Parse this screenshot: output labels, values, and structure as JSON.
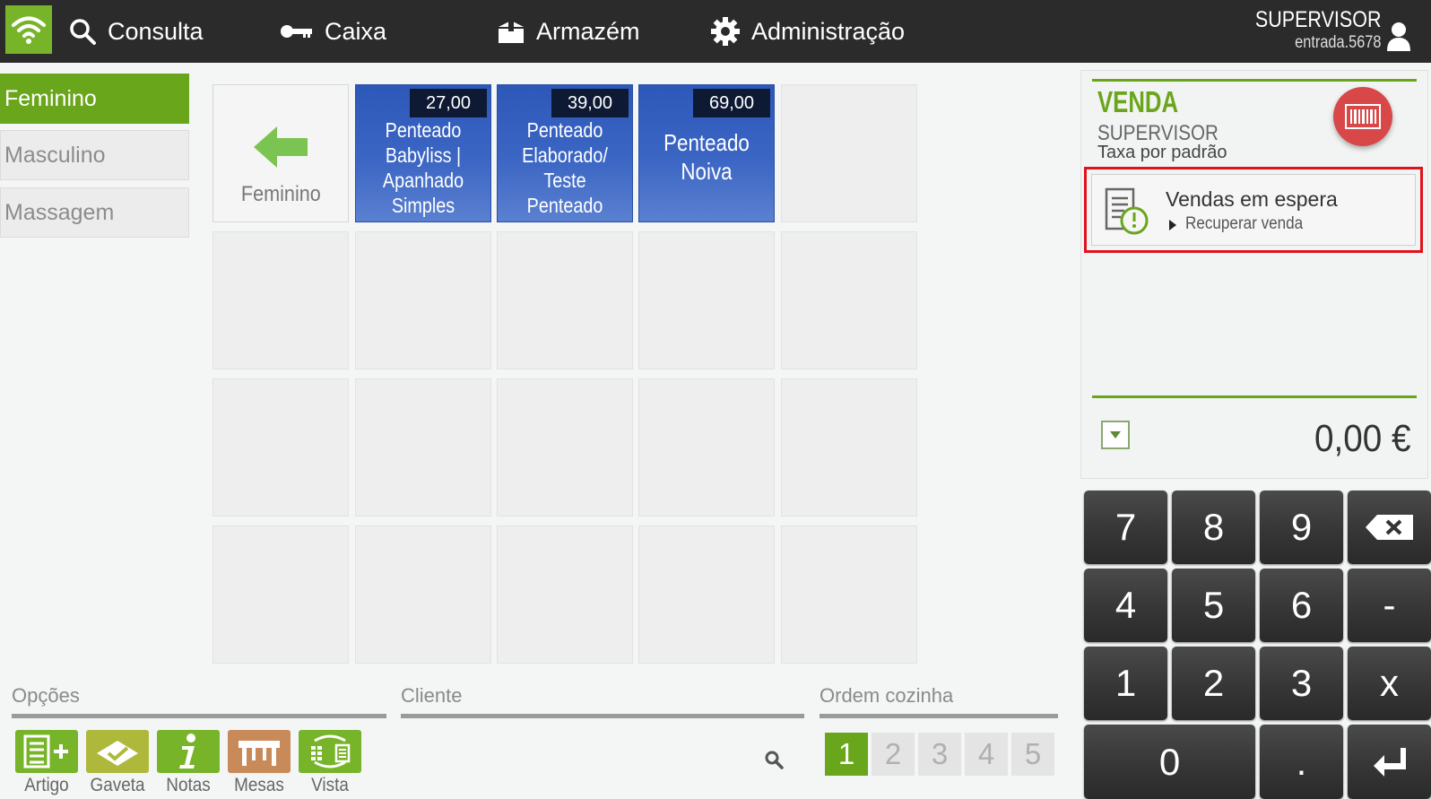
{
  "topbar": {
    "nav": [
      {
        "label": "Consulta",
        "icon": "search-icon"
      },
      {
        "label": "Caixa",
        "icon": "key-icon"
      },
      {
        "label": "Armazém",
        "icon": "box-icon"
      },
      {
        "label": "Administração",
        "icon": "gear-icon"
      }
    ],
    "user_name": "SUPERVISOR",
    "user_sub": "entrada.5678",
    "wifi_color": "#78b42a"
  },
  "categories": [
    {
      "label": "Feminino",
      "active": true
    },
    {
      "label": "Masculino",
      "active": false
    },
    {
      "label": "Massagem",
      "active": false
    }
  ],
  "grid": {
    "back_label": "Feminino",
    "products": [
      {
        "price": "27,00",
        "name_lines": [
          "Penteado",
          "Babyliss |",
          "Apanhado",
          "Simples"
        ]
      },
      {
        "price": "39,00",
        "name_lines": [
          "Penteado",
          "Elaborado/ Teste",
          "Penteado"
        ]
      },
      {
        "price": "69,00",
        "name_lines": [
          "Penteado",
          "Noiva"
        ]
      }
    ]
  },
  "bottom": {
    "options_title": "Opções",
    "client_title": "Cliente",
    "kitchen_title": "Ordem cozinha",
    "options": [
      {
        "label": "Artigo",
        "icon": "add-article-icon",
        "color": "#78b42a"
      },
      {
        "label": "Gaveta",
        "icon": "drawer-icon",
        "color": "#aeb83a"
      },
      {
        "label": "Notas",
        "icon": "info-icon",
        "color": "#78b42a"
      },
      {
        "label": "Mesas",
        "icon": "table-icon",
        "color": "#c98a5a"
      },
      {
        "label": "Vista",
        "icon": "view-switch-icon",
        "color": "#78b42a"
      }
    ],
    "kitchen_orders": [
      "1",
      "2",
      "3",
      "4",
      "5"
    ],
    "kitchen_active": "1"
  },
  "sale": {
    "title": "VENDA",
    "user": "SUPERVISOR",
    "tax": "Taxa por padrão",
    "hold_title": "Vendas em espera",
    "hold_sub": "Recuperar venda",
    "total": "0,00 €"
  },
  "keypad": {
    "keys": [
      "7",
      "8",
      "9",
      "⌫",
      "4",
      "5",
      "6",
      "-",
      "1",
      "2",
      "3",
      "x",
      "0",
      ".",
      "↵"
    ]
  }
}
